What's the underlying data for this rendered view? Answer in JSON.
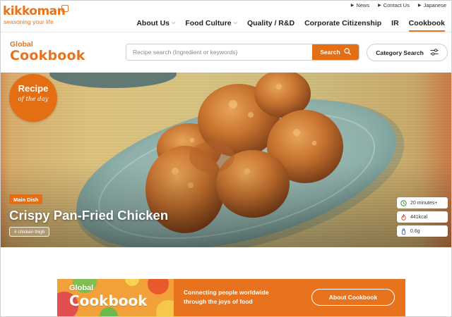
{
  "brand": {
    "name": "kikkoman",
    "tagline": "seasoning your life"
  },
  "utility_nav": [
    {
      "label": "News"
    },
    {
      "label": "Contact Us"
    },
    {
      "label": "Japanese"
    }
  ],
  "main_nav": [
    {
      "label": "About Us",
      "has_dropdown": true
    },
    {
      "label": "Food Culture",
      "has_dropdown": true
    },
    {
      "label": "Quality / R&D",
      "has_dropdown": false
    },
    {
      "label": "Corporate Citizenship",
      "has_dropdown": false
    },
    {
      "label": "IR",
      "has_dropdown": false
    },
    {
      "label": "Cookbook",
      "has_dropdown": false,
      "active": true
    }
  ],
  "cookbook": {
    "logo_small": "Global",
    "logo_big": "Cookbook"
  },
  "search": {
    "placeholder": "Recipe search (Ingredient or keywords)",
    "value": "",
    "button_label": "Search",
    "category_label": "Category Search"
  },
  "hero": {
    "badge_line1": "Recipe",
    "badge_line2": "of the day",
    "category": "Main Dish",
    "title": "Crispy Pan-Fried Chicken",
    "tag": "# chicken thigh",
    "info": {
      "time": "20 minutes+",
      "calories": "441kcal",
      "salt": "0.6g"
    }
  },
  "banner": {
    "logo_small": "Global",
    "logo_big": "Cookbook",
    "text_line1": "Connecting people worldwide",
    "text_line2": "through the joys of food",
    "button_label": "About Cookbook"
  },
  "colors": {
    "accent": "#e36e14",
    "brand_orange": "#e8731e"
  },
  "icons": {
    "search": "magnifier",
    "category": "sliders",
    "time": "clock",
    "calories": "flame",
    "salt": "salt-shaker",
    "external": "arrow-up-right"
  }
}
